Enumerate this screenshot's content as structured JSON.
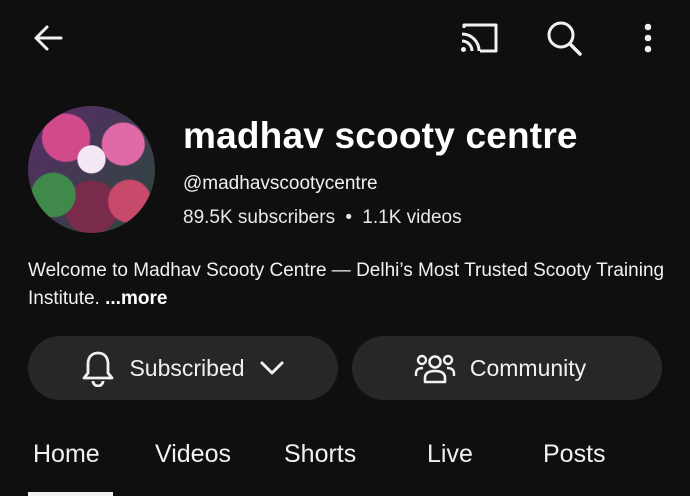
{
  "header": {
    "back_icon": "arrow-left-icon",
    "cast_icon": "cast-icon",
    "search_icon": "search-icon",
    "more_icon": "more-vertical-icon"
  },
  "channel": {
    "name": "madhav scooty centre",
    "handle": "@madhavscootycentre",
    "subscribers": "89.5K subscribers",
    "separator": "•",
    "videos": "1.1K videos",
    "description": "Welcome to Madhav Scooty Centre — Delhi’s Most Trusted Scooty Training Institute. ",
    "more_label": "...more"
  },
  "actions": {
    "subscribe_label": "Subscribed",
    "community_label": "Community"
  },
  "tabs": [
    {
      "label": "Home",
      "selected": true
    },
    {
      "label": "Videos"
    },
    {
      "label": "Shorts"
    },
    {
      "label": "Live"
    },
    {
      "label": "Posts"
    }
  ],
  "colors": {
    "background": "#0f0f0f",
    "pill": "#272727",
    "text": "#f1f1f1"
  }
}
